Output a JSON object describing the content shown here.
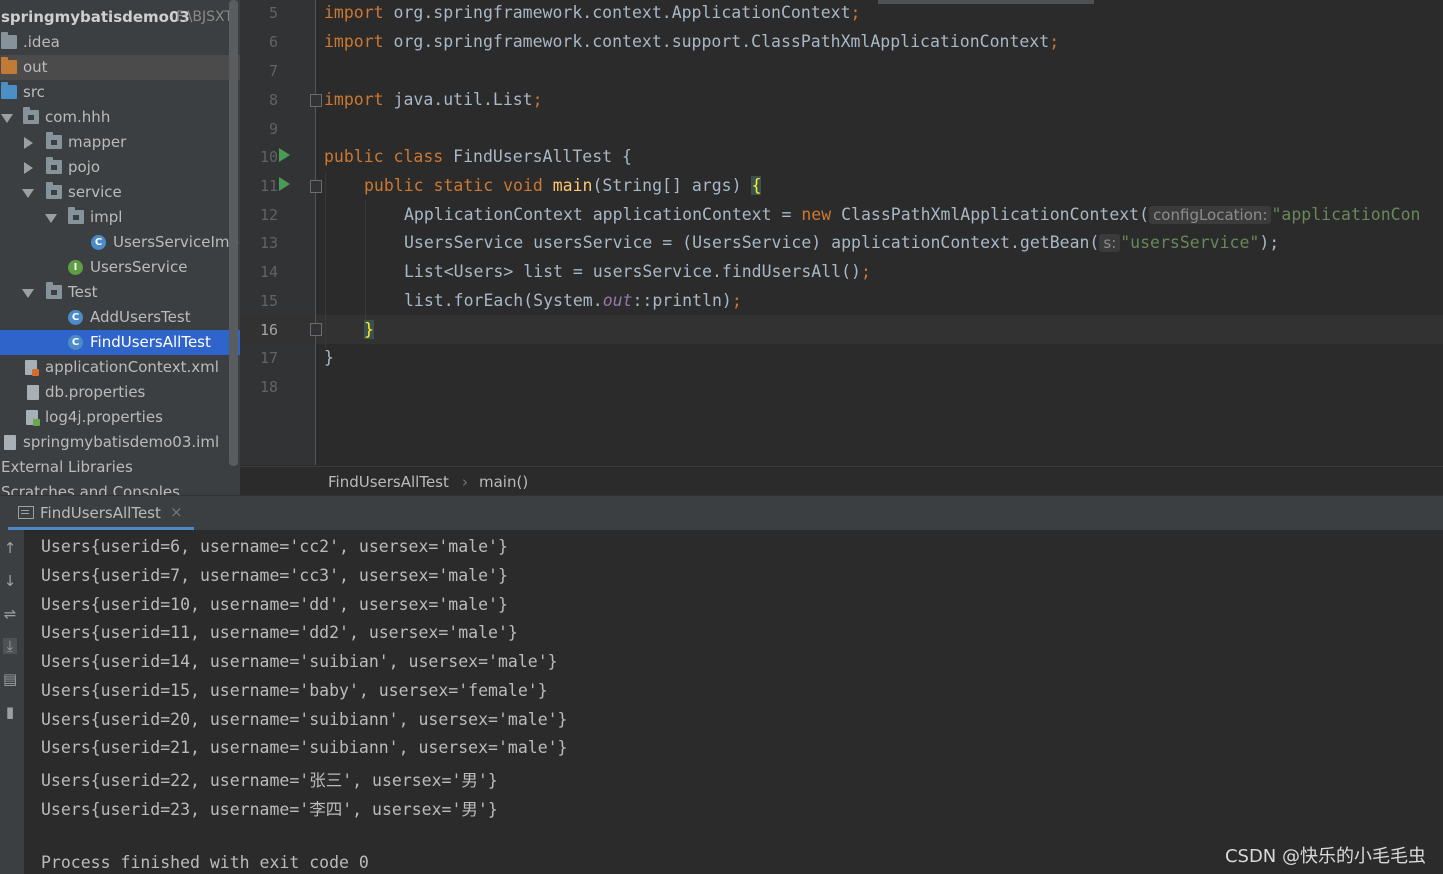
{
  "project_tree": {
    "root_name": "springmybatisdemo03",
    "root_path": "F:\\BJSXT",
    "items": [
      {
        "label": ".idea",
        "icon": "folder-icon"
      },
      {
        "label": "out",
        "icon": "folder-orange-icon"
      },
      {
        "label": "src",
        "icon": "folder-blue-icon"
      },
      {
        "label": "com.hhh",
        "icon": "package-icon"
      },
      {
        "label": "mapper",
        "icon": "package-icon"
      },
      {
        "label": "pojo",
        "icon": "package-icon"
      },
      {
        "label": "service",
        "icon": "package-icon"
      },
      {
        "label": "impl",
        "icon": "package-icon"
      },
      {
        "label": "UsersServiceImpl",
        "icon": "class-icon"
      },
      {
        "label": "UsersService",
        "icon": "interface-icon"
      },
      {
        "label": "Test",
        "icon": "package-icon"
      },
      {
        "label": "AddUsersTest",
        "icon": "test-class-icon"
      },
      {
        "label": "FindUsersAllTest",
        "icon": "test-class-icon"
      },
      {
        "label": "applicationContext.xml",
        "icon": "xml-file-icon"
      },
      {
        "label": "db.properties",
        "icon": "properties-file-icon"
      },
      {
        "label": "log4j.properties",
        "icon": "properties-file-icon"
      },
      {
        "label": "springmybatisdemo03.iml",
        "icon": "module-file-icon"
      },
      {
        "label": "External Libraries",
        "icon": "library-icon"
      },
      {
        "label": "Scratches and Consoles",
        "icon": "scratch-icon"
      }
    ]
  },
  "editor": {
    "line_numbers": [
      "5",
      "6",
      "7",
      "8",
      "9",
      "10",
      "11",
      "12",
      "13",
      "14",
      "15",
      "16",
      "17",
      "18"
    ],
    "active_line": "16",
    "lines": {
      "l5_kw": "import",
      "l5_rest": " org.springframework.context.ApplicationContext",
      "l5_semi": ";",
      "l6_kw": "import",
      "l6_rest": " org.springframework.context.support.ClassPathXmlApplicationContext",
      "l6_semi": ";",
      "l8_kw": "import",
      "l8_rest": " java.util.List",
      "l8_semi": ";",
      "l10_kw": "public class",
      "l10_rest": " FindUsersAllTest {",
      "l11_kw": "public static void",
      "l11_fn": "main",
      "l11_rest": "(String[] args) ",
      "l11_brace": "{",
      "l12_a": "ApplicationContext applicationContext = ",
      "l12_kw": "new",
      "l12_b": " ClassPathXmlApplicationContext(",
      "l12_hint": "configLocation:",
      "l12_str": "\"applicationCon",
      "l13_a": "UsersService usersService = (UsersService) applicationContext.getBean(",
      "l13_hint": "s:",
      "l13_str": "\"usersService\"",
      "l13_end": ");",
      "l14_a": "List<Users> list = usersService.findUsersAll()",
      "l14_semi": ";",
      "l15_a": "list.forEach(System.",
      "l15_it": "out",
      "l15_b": "::println)",
      "l15_semi": ";",
      "l16_brace": "}",
      "l17_brace": "}"
    }
  },
  "breadcrumb": {
    "class_name": "FindUsersAllTest",
    "separator": "›",
    "method": "main()"
  },
  "run_panel": {
    "tab_label": "FindUsersAllTest",
    "tab_close": "×",
    "output": [
      "Users{userid=6, username='cc2', usersex='male'}",
      "Users{userid=7, username='cc3', usersex='male'}",
      "Users{userid=10, username='dd', usersex='male'}",
      "Users{userid=11, username='dd2', usersex='male'}",
      "Users{userid=14, username='suibian', usersex='male'}",
      "Users{userid=15, username='baby', usersex='female'}",
      "Users{userid=20, username='suibiann', usersex='male'}",
      "Users{userid=21, username='suibiann', usersex='male'}",
      "Users{userid=22, username='张三', usersex='男'}",
      "Users{userid=23, username='李四', usersex='男'}"
    ],
    "exit_message": "Process finished with exit code 0"
  },
  "watermark": "CSDN @快乐的小毛毛虫",
  "colors": {
    "keyword": "#cc7832",
    "function": "#ffc66d",
    "string": "#6a8759",
    "selection": "#2f65ca"
  }
}
